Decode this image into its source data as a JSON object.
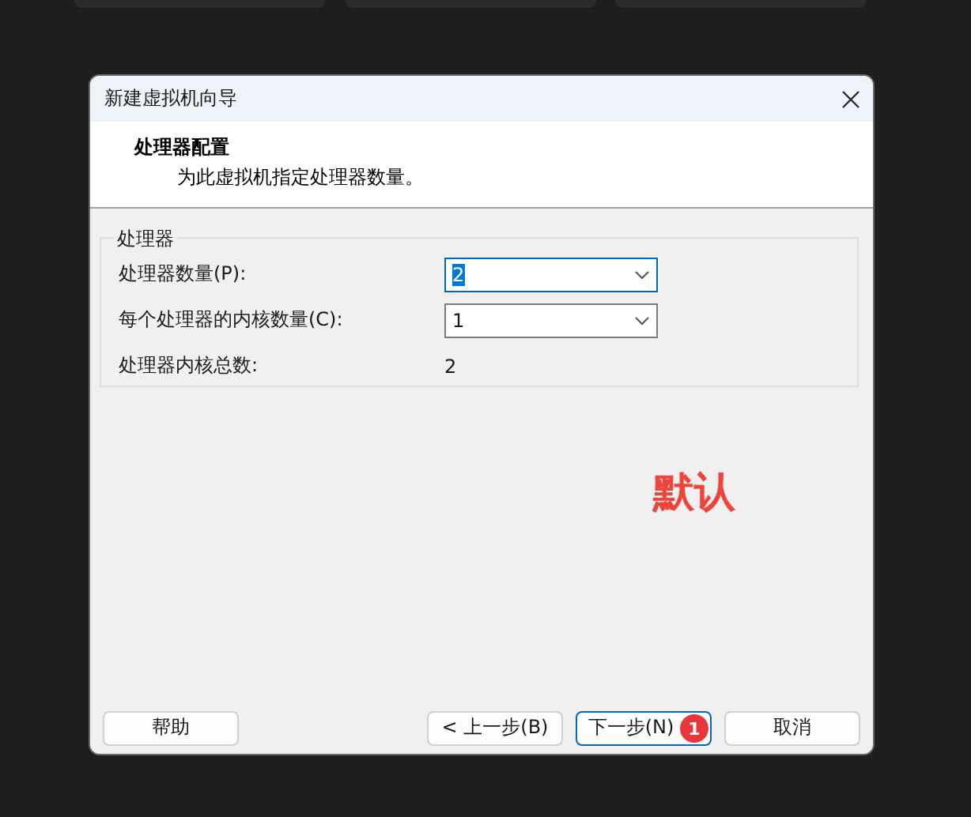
{
  "window": {
    "title": "新建虚拟机向导"
  },
  "header": {
    "title": "处理器配置",
    "subtitle": "为此虚拟机指定处理器数量。"
  },
  "group": {
    "legend": "处理器",
    "rows": [
      {
        "kind": "combo",
        "label": "处理器数量(P):",
        "value": "2",
        "focused": true
      },
      {
        "kind": "combo",
        "label": "每个处理器的内核数量(C):",
        "value": "1",
        "focused": false
      },
      {
        "kind": "readout",
        "label": "处理器内核总数:",
        "value": "2"
      }
    ]
  },
  "annotation": "默认",
  "buttons": [
    {
      "label": "帮助",
      "default": false
    },
    {
      "label": "< 上一步(B)",
      "default": false
    },
    {
      "label": "下一步(N)",
      "default": true,
      "badge": "1"
    },
    {
      "label": "取消",
      "default": false
    }
  ]
}
